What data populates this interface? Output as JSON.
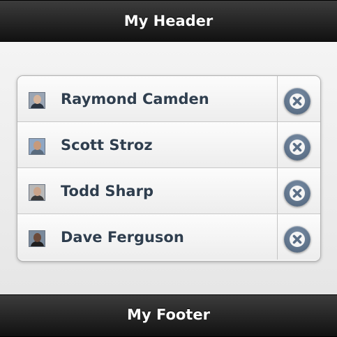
{
  "header": {
    "title": "My Header"
  },
  "footer": {
    "title": "My Footer"
  },
  "list": {
    "items": [
      {
        "name": "Raymond Camden",
        "avatar": {
          "bg": "#9aa5b4",
          "skin": "#d6b49b",
          "shirt": "#2b3442"
        }
      },
      {
        "name": "Scott Stroz",
        "avatar": {
          "bg": "#8fa7c4",
          "skin": "#c79a7c",
          "shirt": "#5a6b7e"
        }
      },
      {
        "name": "Todd Sharp",
        "avatar": {
          "bg": "#b8b8b8",
          "skin": "#caa48a",
          "shirt": "#3a3a3a"
        }
      },
      {
        "name": "Dave Ferguson",
        "avatar": {
          "bg": "#7a8a9c",
          "skin": "#6b4a3a",
          "shirt": "#1f1f1f"
        }
      }
    ]
  },
  "colors": {
    "name_text": "#2f3e4e",
    "delete_button": "#5a6e86",
    "bar_background": "#1a1a1a"
  },
  "icons": {
    "delete": "delete-icon"
  }
}
